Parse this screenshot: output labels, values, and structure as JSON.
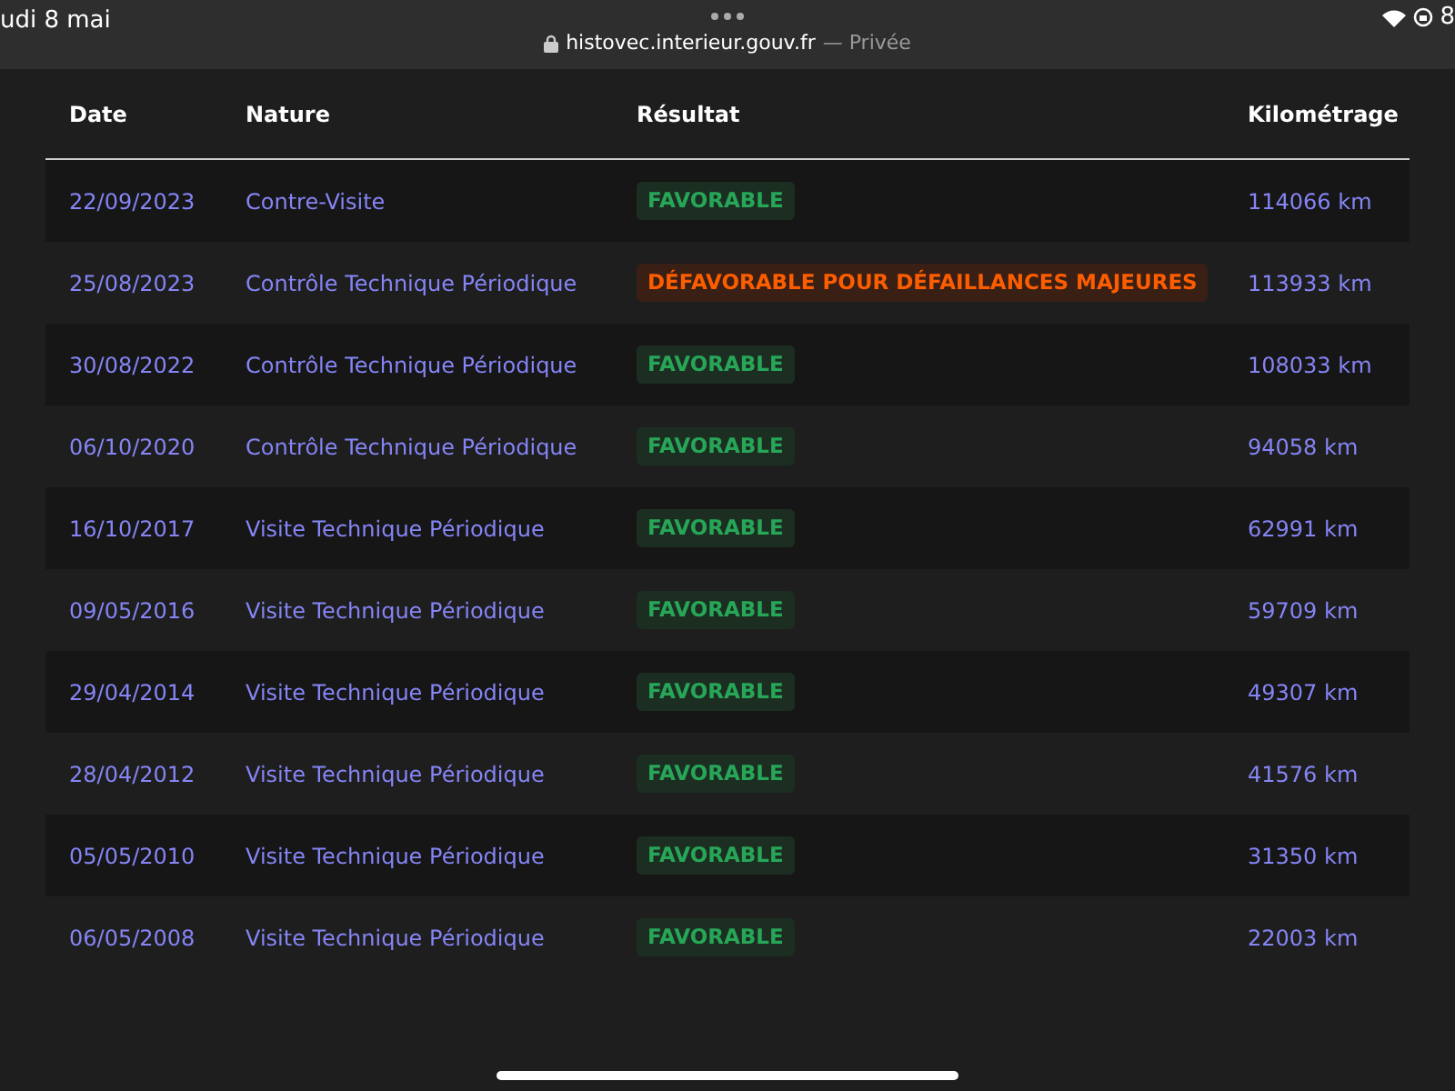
{
  "status_bar": {
    "date": "udi 8 mai",
    "url": "histovec.interieur.gouv.fr",
    "mode": "— Privée",
    "battery": "8"
  },
  "table": {
    "columns": [
      "Date",
      "Nature",
      "Résultat",
      "Kilométrage"
    ],
    "rows": [
      {
        "date": "22/09/2023",
        "nature": "Contre-Visite",
        "result": "FAVORABLE",
        "kind": "favorable",
        "km": "114066 km"
      },
      {
        "date": "25/08/2023",
        "nature": "Contrôle Technique Périodique",
        "result": "DÉFAVORABLE POUR DÉFAILLANCES MAJEURES",
        "kind": "unfavorable",
        "km": "113933 km"
      },
      {
        "date": "30/08/2022",
        "nature": "Contrôle Technique Périodique",
        "result": "FAVORABLE",
        "kind": "favorable",
        "km": "108033 km"
      },
      {
        "date": "06/10/2020",
        "nature": "Contrôle Technique Périodique",
        "result": "FAVORABLE",
        "kind": "favorable",
        "km": "94058 km"
      },
      {
        "date": "16/10/2017",
        "nature": "Visite Technique Périodique",
        "result": "FAVORABLE",
        "kind": "favorable",
        "km": "62991 km"
      },
      {
        "date": "09/05/2016",
        "nature": "Visite Technique Périodique",
        "result": "FAVORABLE",
        "kind": "favorable",
        "km": "59709 km"
      },
      {
        "date": "29/04/2014",
        "nature": "Visite Technique Périodique",
        "result": "FAVORABLE",
        "kind": "favorable",
        "km": "49307 km"
      },
      {
        "date": "28/04/2012",
        "nature": "Visite Technique Périodique",
        "result": "FAVORABLE",
        "kind": "favorable",
        "km": "41576 km"
      },
      {
        "date": "05/05/2010",
        "nature": "Visite Technique Périodique",
        "result": "FAVORABLE",
        "kind": "favorable",
        "km": "31350 km"
      },
      {
        "date": "06/05/2008",
        "nature": "Visite Technique Périodique",
        "result": "FAVORABLE",
        "kind": "favorable",
        "km": "22003 km"
      }
    ]
  }
}
